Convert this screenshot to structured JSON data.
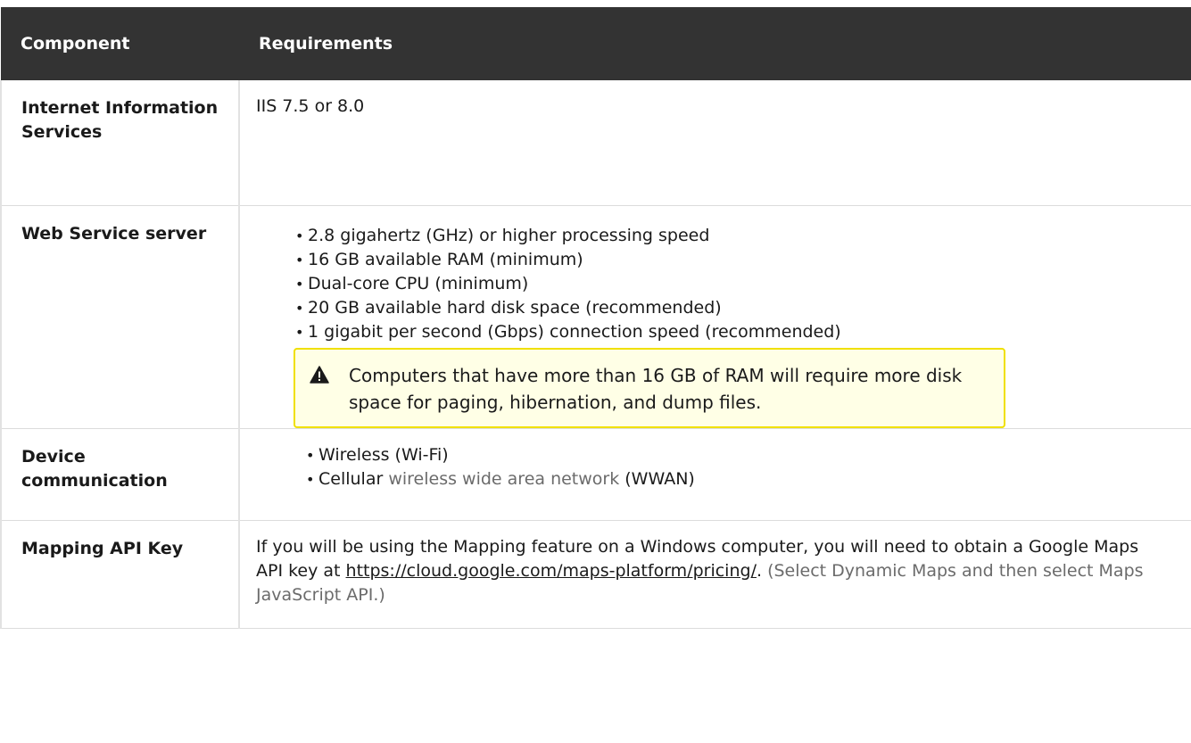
{
  "table": {
    "headers": [
      "Component",
      "Requirements"
    ],
    "rows": {
      "iis": {
        "component": "Internet Information Services",
        "requirement": "IIS 7.5 or 8.0"
      },
      "web_service": {
        "component": "Web Service server",
        "items": [
          "2.8 gigahertz (GHz) or higher processing speed",
          "16 GB available RAM (minimum)",
          "Dual-core CPU (minimum)",
          "20 GB available hard disk space (recommended)",
          "1 gigabit per second (Gbps) connection speed (recommended)"
        ],
        "warning": "Computers that have more than 16 GB of RAM will require more disk space for paging, hibernation, and dump files."
      },
      "device": {
        "component": "Device communication",
        "item1": "Wireless (Wi-Fi)",
        "item2_prefix": "Cellular ",
        "item2_link": "wireless wide area network",
        "item2_suffix": " (WWAN)"
      },
      "mapping": {
        "component": "Mapping API Key",
        "text_prefix": "If you will be using the Mapping feature on a Windows computer, you will need to obtain a Google Maps API key at ",
        "link": "https://cloud.google.com/maps-platform/pricing/",
        "text_period": ". ",
        "note": "(Select Dynamic Maps and then select Maps JavaScript API.)"
      }
    }
  },
  "colors": {
    "header_bg": "#333333",
    "warning_bg": "#ffffe6",
    "warning_border": "#f0e000"
  }
}
